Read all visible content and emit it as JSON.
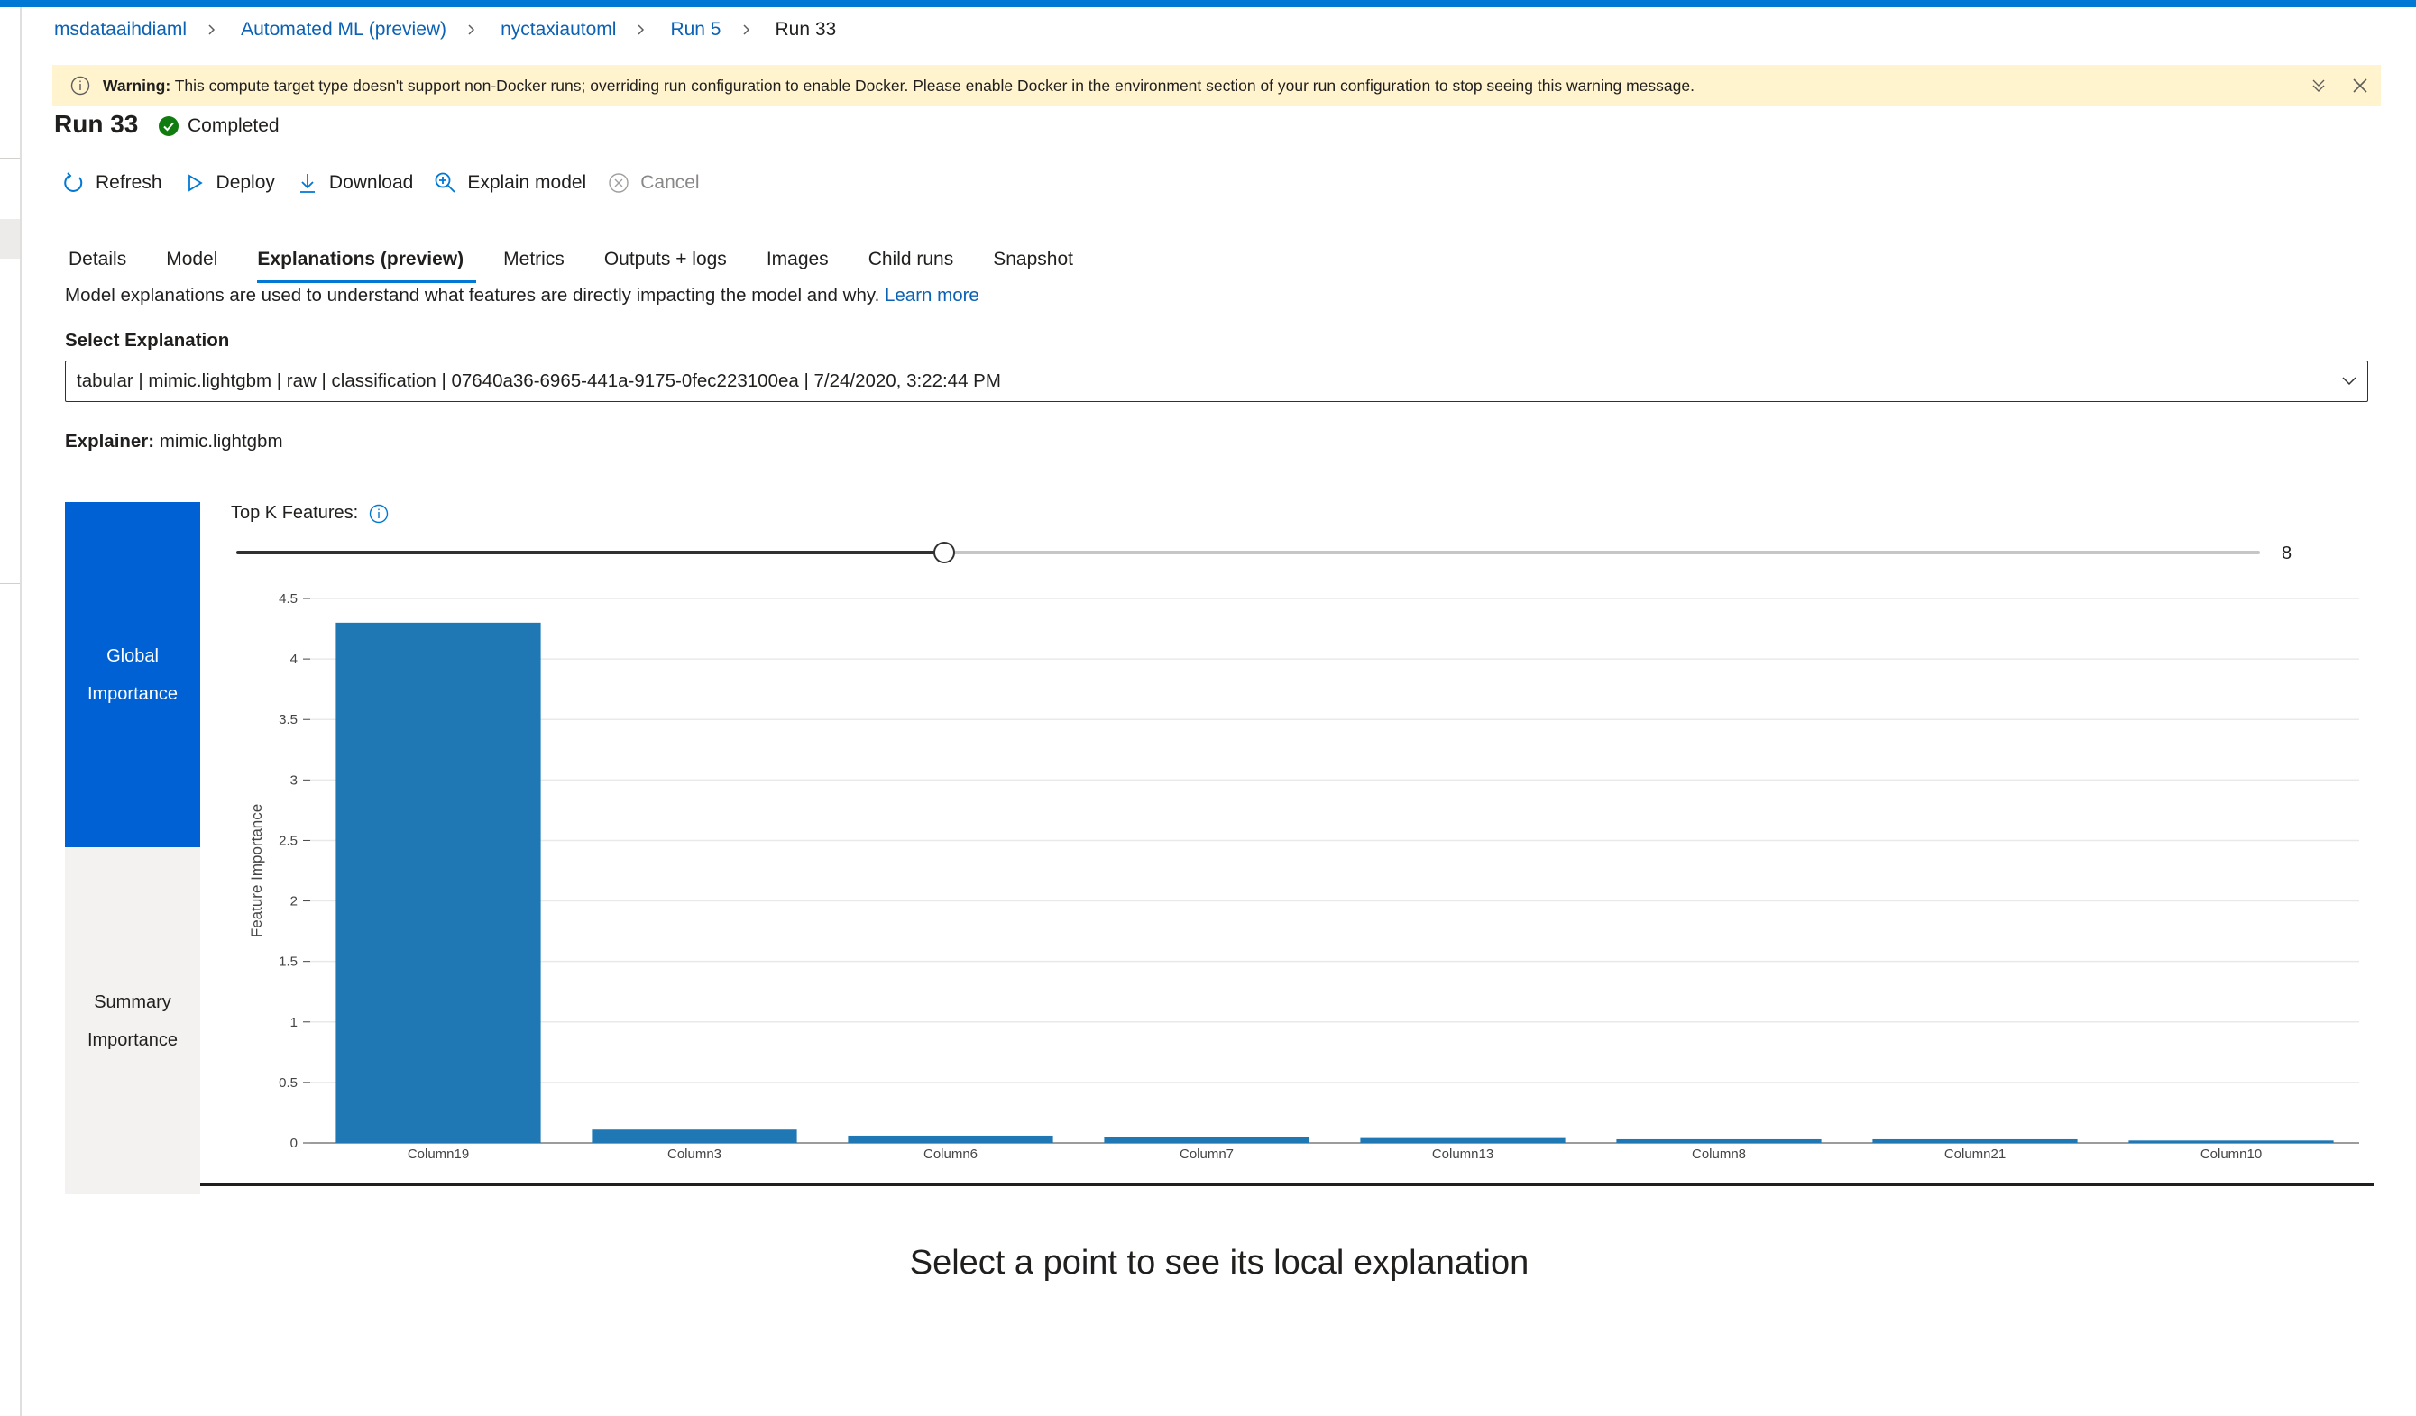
{
  "breadcrumb": {
    "items": [
      "msdataaihdiaml",
      "Automated ML (preview)",
      "nyctaxiautoml",
      "Run 5"
    ],
    "current": "Run 33"
  },
  "warning": {
    "label": "Warning:",
    "text": "This compute target type doesn't support non-Docker runs; overriding run configuration to enable Docker. Please enable Docker in the environment section of your run configuration to stop seeing this warning message."
  },
  "run": {
    "title": "Run 33",
    "status": "Completed",
    "status_color": "#107c10"
  },
  "toolbar": {
    "refresh": "Refresh",
    "deploy": "Deploy",
    "download": "Download",
    "explain": "Explain model",
    "cancel": "Cancel"
  },
  "tabs": [
    "Details",
    "Model",
    "Explanations (preview)",
    "Metrics",
    "Outputs + logs",
    "Images",
    "Child runs",
    "Snapshot"
  ],
  "active_tab": "Explanations (preview)",
  "description": {
    "text": "Model explanations are used to understand what features are directly impacting the model and why.",
    "link": "Learn more"
  },
  "select_explanation": {
    "label": "Select Explanation",
    "value": "tabular | mimic.lightgbm | raw | classification | 07640a36-6965-441a-9175-0fec223100ea | 7/24/2020, 3:22:44 PM"
  },
  "explainer": {
    "label": "Explainer:",
    "value": "mimic.lightgbm"
  },
  "pivots": {
    "global": [
      "Global",
      "Importance"
    ],
    "summary": [
      "Summary",
      "Importance"
    ]
  },
  "topk": {
    "label": "Top K Features:",
    "value": "8",
    "min": 1,
    "max": 21,
    "level": 8
  },
  "accent_color": "#0078d4",
  "chart_data": {
    "type": "bar",
    "categories": [
      "Column19",
      "Column3",
      "Column6",
      "Column7",
      "Column13",
      "Column8",
      "Column21",
      "Column10"
    ],
    "values": [
      4.3,
      0.11,
      0.06,
      0.05,
      0.04,
      0.03,
      0.03,
      0.02
    ],
    "xlabel": "",
    "ylabel": "Feature Importance",
    "ylim": [
      0,
      4.5
    ],
    "yticks": [
      "0",
      "0.5",
      "1",
      "1.5",
      "2",
      "2.5",
      "3",
      "3.5",
      "4",
      "4.5"
    ],
    "grid": true,
    "bar_color": "#1f77b4"
  },
  "local_message": "Select a point to see its local explanation"
}
